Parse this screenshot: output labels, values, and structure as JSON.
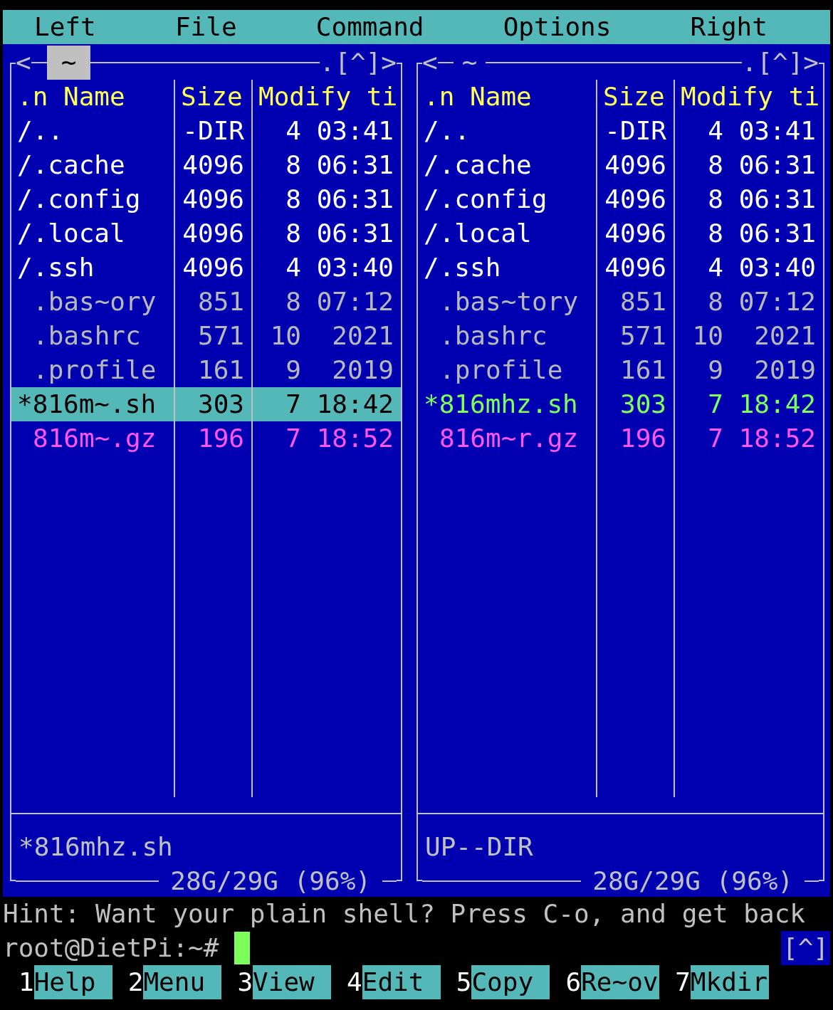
{
  "menu_bar": [
    {
      "label": "Left"
    },
    {
      "label": "File"
    },
    {
      "label": "Command"
    },
    {
      "label": "Options"
    },
    {
      "label": "Right"
    }
  ],
  "panels": [
    {
      "active": true,
      "history_arrow": "<",
      "path": "~",
      "controls": ".[^]>",
      "columns": [
        ".n Name",
        "Size",
        "Modify ti"
      ],
      "rows": [
        {
          "kind": "dir",
          "name": "/..",
          "size": "-DIR",
          "modified": "4 03:41",
          "selected": false
        },
        {
          "kind": "dir",
          "name": "/.cache",
          "size": "4096",
          "modified": "8 06:31",
          "selected": false
        },
        {
          "kind": "dir",
          "name": "/.config",
          "size": "4096",
          "modified": "8 06:31",
          "selected": false
        },
        {
          "kind": "dir",
          "name": "/.local",
          "size": "4096",
          "modified": "8 06:31",
          "selected": false
        },
        {
          "kind": "dir",
          "name": "/.ssh",
          "size": "4096",
          "modified": "4 03:40",
          "selected": false
        },
        {
          "kind": "file",
          "name": ".bas~ory",
          "size": "851",
          "modified": "8 07:12",
          "selected": false
        },
        {
          "kind": "file",
          "name": ".bashrc",
          "size": "571",
          "modified": "10  2021",
          "selected": false
        },
        {
          "kind": "file",
          "name": ".profile",
          "size": "161",
          "modified": "9  2019",
          "selected": false
        },
        {
          "kind": "exec",
          "name": "*816m~.sh",
          "size": "303",
          "modified": "7 18:42",
          "selected": true
        },
        {
          "kind": "archive",
          "name": "816m~.gz",
          "size": "196",
          "modified": "7 18:52",
          "selected": false
        }
      ],
      "status": "*816mhz.sh",
      "disk": "28G/29G (96%)"
    },
    {
      "active": false,
      "history_arrow": "<",
      "path": "~",
      "controls": ".[^]>",
      "columns": [
        ".n Name",
        "Size",
        "Modify ti"
      ],
      "rows": [
        {
          "kind": "dir",
          "name": "/..",
          "size": "-DIR",
          "modified": "4 03:41",
          "selected": false
        },
        {
          "kind": "dir",
          "name": "/.cache",
          "size": "4096",
          "modified": "8 06:31",
          "selected": false
        },
        {
          "kind": "dir",
          "name": "/.config",
          "size": "4096",
          "modified": "8 06:31",
          "selected": false
        },
        {
          "kind": "dir",
          "name": "/.local",
          "size": "4096",
          "modified": "8 06:31",
          "selected": false
        },
        {
          "kind": "dir",
          "name": "/.ssh",
          "size": "4096",
          "modified": "4 03:40",
          "selected": false
        },
        {
          "kind": "file",
          "name": ".bas~tory",
          "size": "851",
          "modified": "8 07:12",
          "selected": false
        },
        {
          "kind": "file",
          "name": ".bashrc",
          "size": "571",
          "modified": "10  2021",
          "selected": false
        },
        {
          "kind": "file",
          "name": ".profile",
          "size": "161",
          "modified": "9  2019",
          "selected": false
        },
        {
          "kind": "exec",
          "name": "*816mhz.sh",
          "size": "303",
          "modified": "7 18:42",
          "selected": false
        },
        {
          "kind": "archive",
          "name": "816m~r.gz",
          "size": "196",
          "modified": "7 18:52",
          "selected": false
        }
      ],
      "status": "UP--DIR",
      "disk": "28G/29G (96%)"
    }
  ],
  "hint": "Hint: Want your plain shell? Press C-o, and get back",
  "prompt": "root@DietPi:~#",
  "prompt_indicator": "[^]",
  "function_keys": [
    {
      "number": "1",
      "label": "Help"
    },
    {
      "number": "2",
      "label": "Menu"
    },
    {
      "number": "3",
      "label": "View"
    },
    {
      "number": "4",
      "label": "Edit"
    },
    {
      "number": "5",
      "label": "Copy"
    },
    {
      "number": "6",
      "label": "Re~ov"
    },
    {
      "number": "7",
      "label": "Mkdir"
    }
  ]
}
